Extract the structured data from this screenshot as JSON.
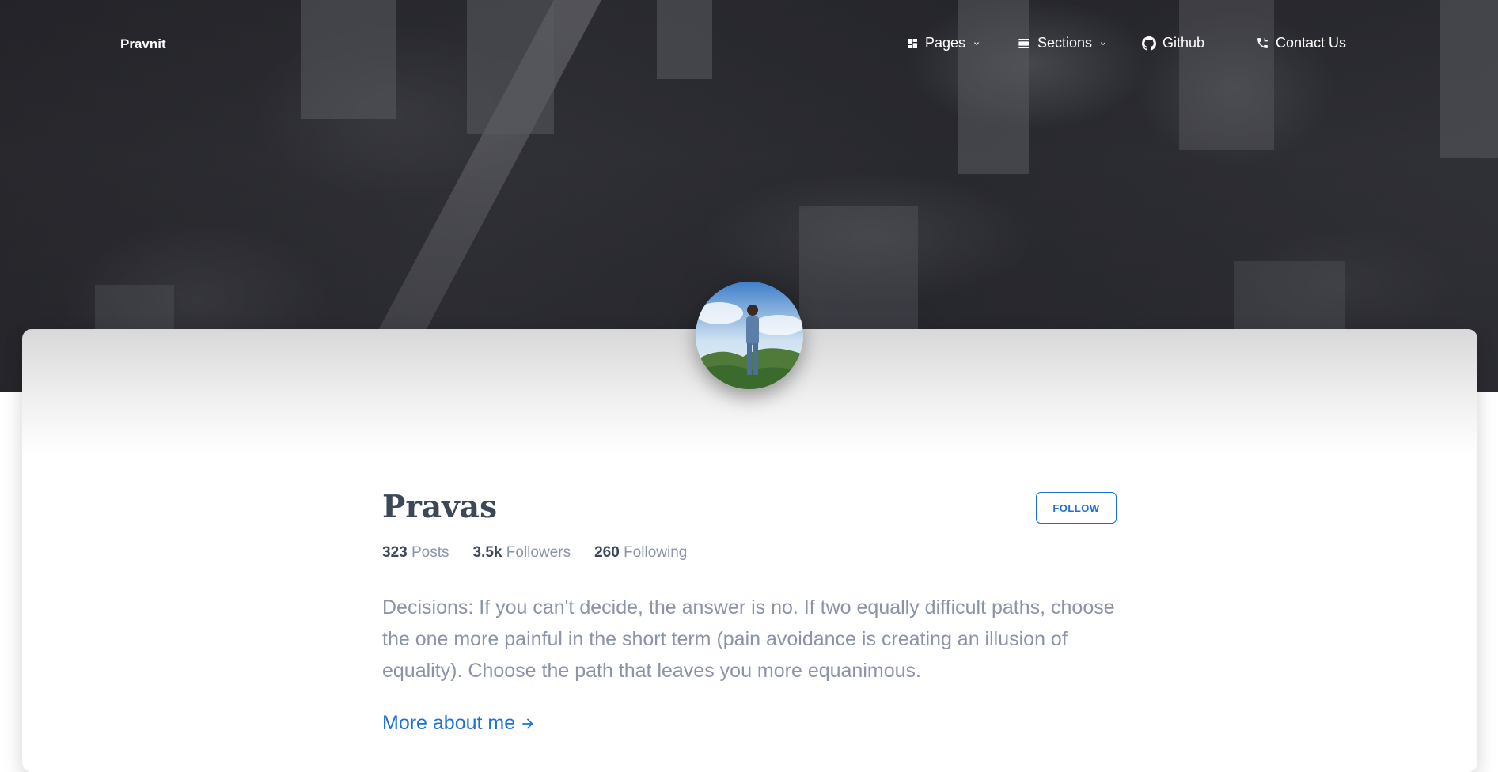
{
  "nav": {
    "brand": "Pravnit",
    "items": [
      {
        "label": "Pages",
        "icon": "dashboard-icon",
        "has_dropdown": true
      },
      {
        "label": "Sections",
        "icon": "view-day-icon",
        "has_dropdown": true
      },
      {
        "label": "Github",
        "icon": "github-icon",
        "has_dropdown": false
      },
      {
        "label": "Contact Us",
        "icon": "phone-icon",
        "has_dropdown": false
      }
    ]
  },
  "profile": {
    "name": "Pravas",
    "follow_label": "FOLLOW",
    "stats": [
      {
        "value": "323",
        "label": "Posts"
      },
      {
        "value": "3.5k",
        "label": "Followers"
      },
      {
        "value": "260",
        "label": "Following"
      }
    ],
    "bio": "Decisions: If you can't decide, the answer is no. If two equally difficult paths, choose the one more painful in the short term (pain avoidance is creating an illusion of equality). Choose the path that leaves you more equanimous.",
    "more_link": "More about me"
  },
  "colors": {
    "accent": "#1e6fd9",
    "heading": "#3c4858",
    "muted": "#8a94a6"
  }
}
